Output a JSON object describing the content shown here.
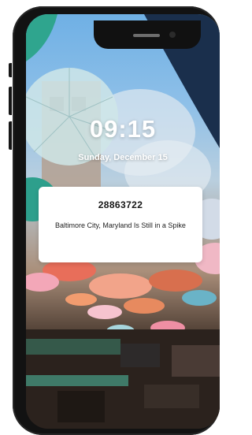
{
  "lock_screen": {
    "time": "09:15",
    "date": "Sunday, December 15",
    "notification": {
      "title": "28863722",
      "body": "Baltimore City, Maryland Is Still in a Spike"
    }
  },
  "colors": {
    "phone_frame": "#121212",
    "notification_bg": "#ffffff",
    "text_light": "#ffffff"
  },
  "wallpaper_icons": [
    "umbrellas-scene"
  ]
}
